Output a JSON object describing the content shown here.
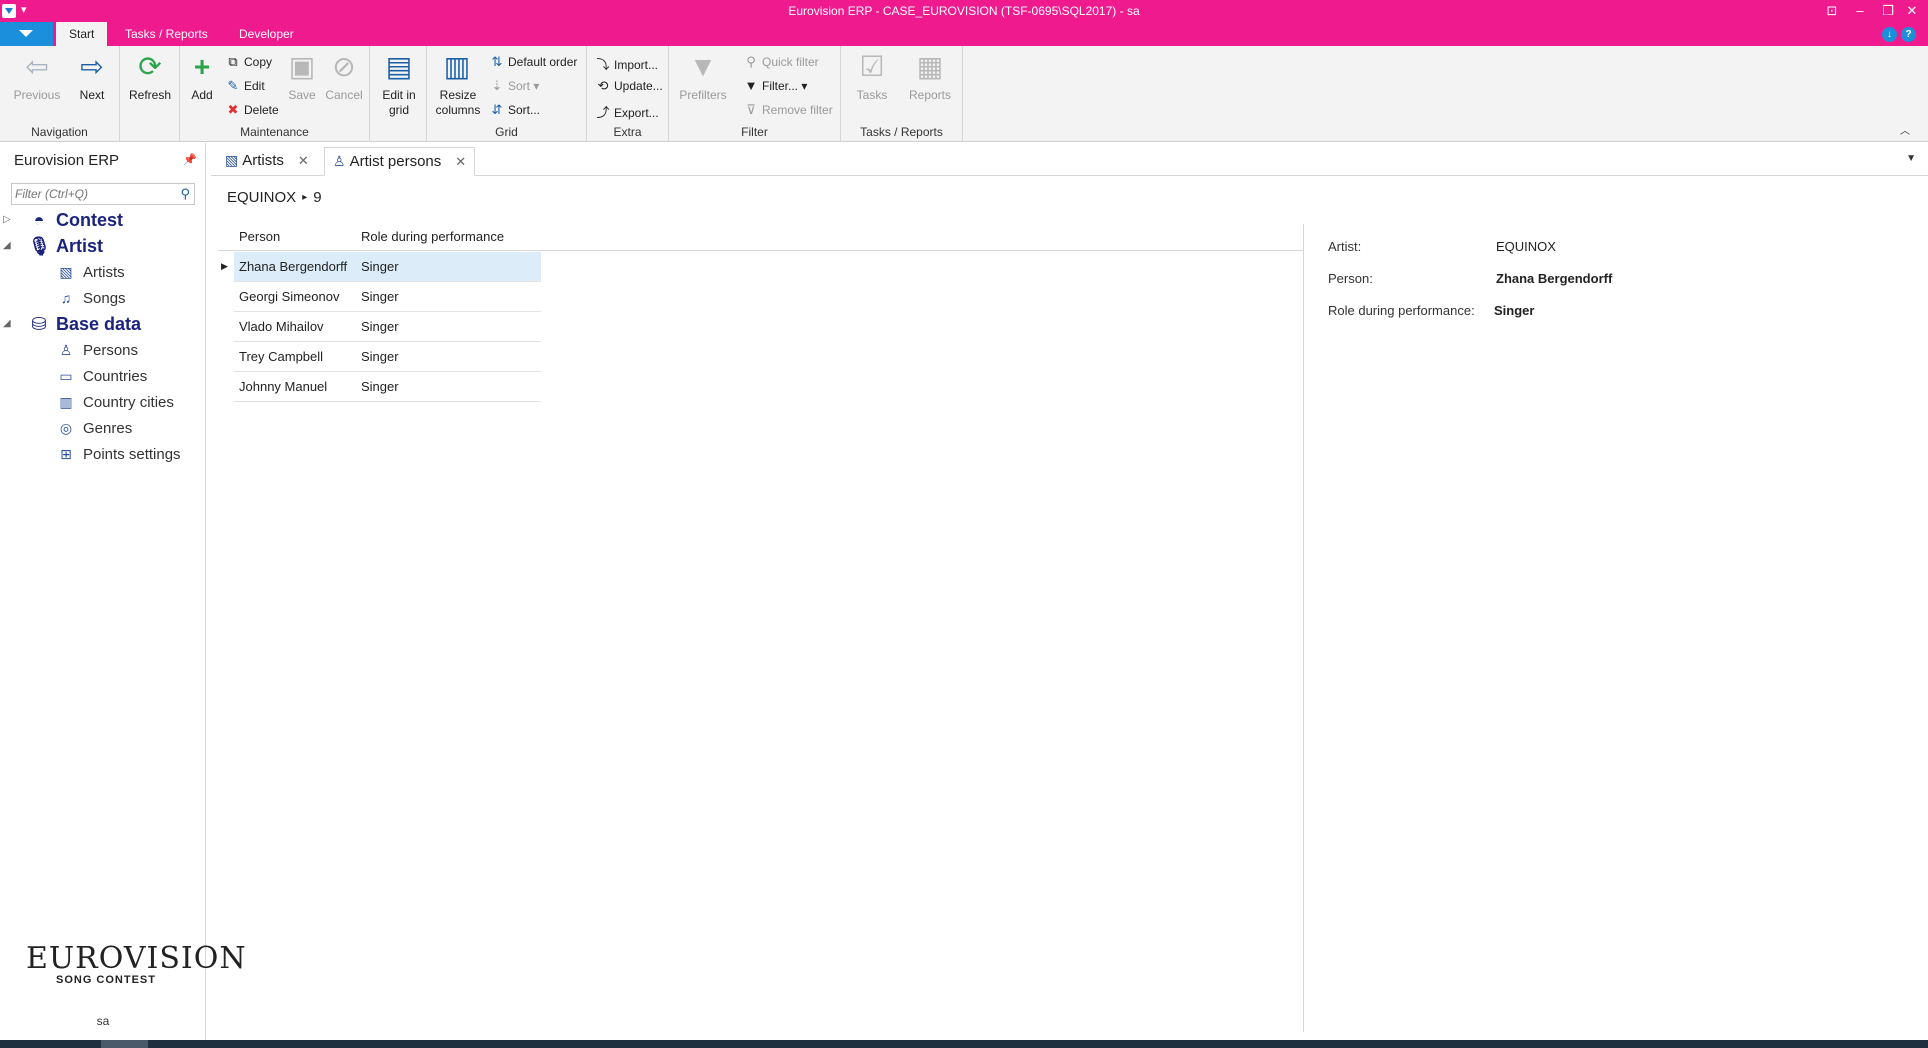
{
  "window": {
    "title": "Eurovision ERP - CASE_EUROVISION (TSF-0695\\SQL2017) - sa",
    "controls": [
      "⊡",
      "–",
      "❐",
      "✕"
    ]
  },
  "ribbon_tabs": [
    {
      "label": "Start",
      "active": true
    },
    {
      "label": "Tasks / Reports",
      "active": false
    },
    {
      "label": "Developer",
      "active": false
    }
  ],
  "ribbon": {
    "navigation": {
      "label": "Navigation",
      "previous": "Previous",
      "next": "Next"
    },
    "refresh": "Refresh",
    "maintenance": {
      "label": "Maintenance",
      "add": "Add",
      "copy": "Copy",
      "edit": "Edit",
      "delete": "Delete",
      "save": "Save",
      "cancel": "Cancel"
    },
    "edit_in_grid": "Edit in grid",
    "grid": {
      "label": "Grid",
      "resize_columns": "Resize columns",
      "default_order": "Default order",
      "sort": "Sort",
      "sort_dialog": "Sort..."
    },
    "extra": {
      "label": "Extra",
      "import": "Import...",
      "update": "Update...",
      "export": "Export..."
    },
    "filter": {
      "label": "Filter",
      "prefilters": "Prefilters",
      "quick_filter": "Quick filter",
      "filter": "Filter...",
      "remove_filter": "Remove filter"
    },
    "tasks_reports": {
      "label": "Tasks / Reports",
      "tasks": "Tasks",
      "reports": "Reports"
    }
  },
  "nav": {
    "title": "Eurovision ERP",
    "search_placeholder": "Filter (Ctrl+Q)",
    "groups": [
      {
        "label": "Contest",
        "expanded": false,
        "items": []
      },
      {
        "label": "Artist",
        "expanded": true,
        "items": [
          "Artists",
          "Songs"
        ]
      },
      {
        "label": "Base data",
        "expanded": true,
        "items": [
          "Persons",
          "Countries",
          "Country cities",
          "Genres",
          "Points settings"
        ]
      }
    ],
    "logo_main": "EUROVISION",
    "logo_sub": "SONG CONTEST",
    "user": "sa"
  },
  "doc_tabs": [
    {
      "label": "Artists",
      "active": false
    },
    {
      "label": "Artist persons",
      "active": true
    }
  ],
  "breadcrumb": {
    "parent": "EQUINOX",
    "separator": "▸",
    "current": "9"
  },
  "grid": {
    "columns": [
      "Person",
      "Role during performance"
    ],
    "rows": [
      {
        "person": "Zhana Bergendorff",
        "role": "Singer",
        "selected": true
      },
      {
        "person": "Georgi Simeonov",
        "role": "Singer",
        "selected": false
      },
      {
        "person": "Vlado Mihailov",
        "role": "Singer",
        "selected": false
      },
      {
        "person": "Trey Campbell",
        "role": "Singer",
        "selected": false
      },
      {
        "person": "Johnny Manuel",
        "role": "Singer",
        "selected": false
      }
    ]
  },
  "detail": {
    "artist_label": "Artist:",
    "artist_value": "EQUINOX",
    "person_label": "Person:",
    "person_value": "Zhana Bergendorff",
    "role_label": "Role during performance:",
    "role_value": "Singer"
  },
  "colors": {
    "title_bar": "#ef1a8e",
    "accent_blue": "#1b8fdc",
    "selected_row": "#dcecf8",
    "nav_group": "#1a237e"
  }
}
